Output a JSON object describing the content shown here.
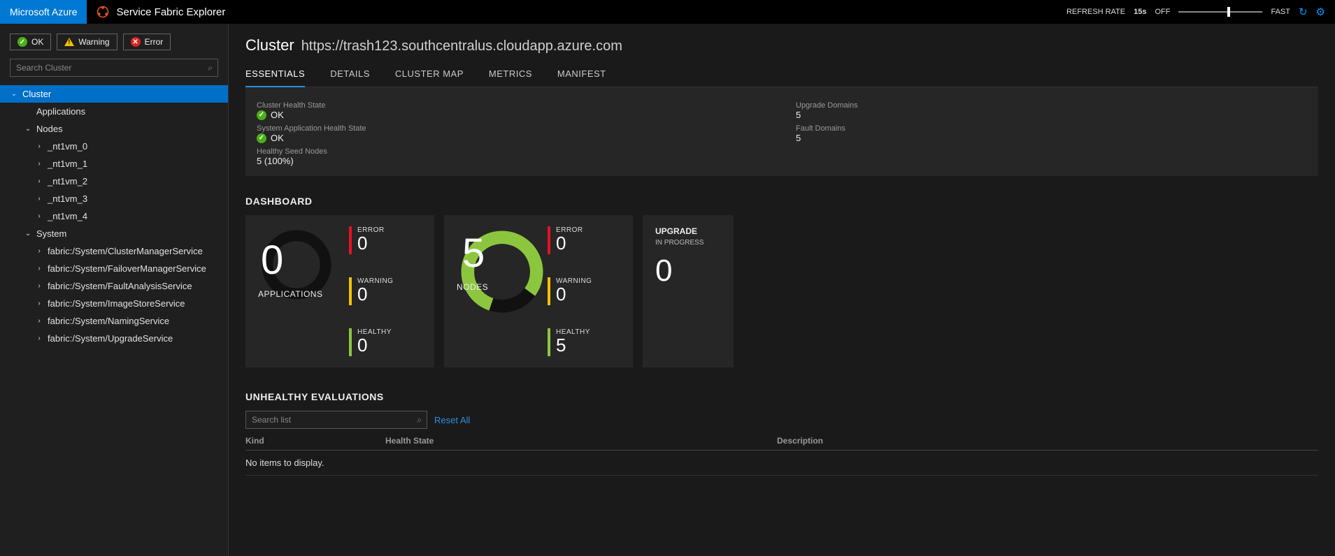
{
  "brand": {
    "azure": "Microsoft Azure",
    "app": "Service Fabric Explorer"
  },
  "topbar": {
    "refresh_label": "REFRESH RATE",
    "refresh_value": "15s",
    "off": "OFF",
    "fast": "FAST"
  },
  "filters": {
    "ok": "OK",
    "warning": "Warning",
    "error": "Error"
  },
  "search_placeholder": "Search Cluster",
  "tree": {
    "root": "Cluster",
    "applications": "Applications",
    "nodes_label": "Nodes",
    "nodes": [
      "_nt1vm_0",
      "_nt1vm_1",
      "_nt1vm_2",
      "_nt1vm_3",
      "_nt1vm_4"
    ],
    "system_label": "System",
    "system": [
      "fabric:/System/ClusterManagerService",
      "fabric:/System/FailoverManagerService",
      "fabric:/System/FaultAnalysisService",
      "fabric:/System/ImageStoreService",
      "fabric:/System/NamingService",
      "fabric:/System/UpgradeService"
    ]
  },
  "page": {
    "title": "Cluster",
    "url": "https://trash123.southcentralus.cloudapp.azure.com"
  },
  "tabs": [
    "ESSENTIALS",
    "DETAILS",
    "CLUSTER MAP",
    "METRICS",
    "MANIFEST"
  ],
  "essentials": {
    "chs_label": "Cluster Health State",
    "chs_value": "OK",
    "sahs_label": "System Application Health State",
    "sahs_value": "OK",
    "hsn_label": "Healthy Seed Nodes",
    "hsn_value": "5 (100%)",
    "ud_label": "Upgrade Domains",
    "ud_value": "5",
    "fd_label": "Fault Domains",
    "fd_value": "5"
  },
  "dashboard": {
    "title": "DASHBOARD",
    "apps": {
      "count": "0",
      "label": "APPLICATIONS",
      "error": "0",
      "warning": "0",
      "healthy": "0"
    },
    "nodes": {
      "count": "5",
      "label": "NODES",
      "error": "0",
      "warning": "0",
      "healthy": "5"
    },
    "upgrade": {
      "l1": "UPGRADE",
      "l2": "IN PROGRESS",
      "count": "0"
    },
    "mlabels": {
      "error": "ERROR",
      "warning": "WARNING",
      "healthy": "HEALTHY"
    }
  },
  "evals": {
    "title": "UNHEALTHY EVALUATIONS",
    "search_placeholder": "Search list",
    "reset": "Reset All",
    "cols": {
      "kind": "Kind",
      "hs": "Health State",
      "desc": "Description"
    },
    "empty": "No items to display."
  }
}
